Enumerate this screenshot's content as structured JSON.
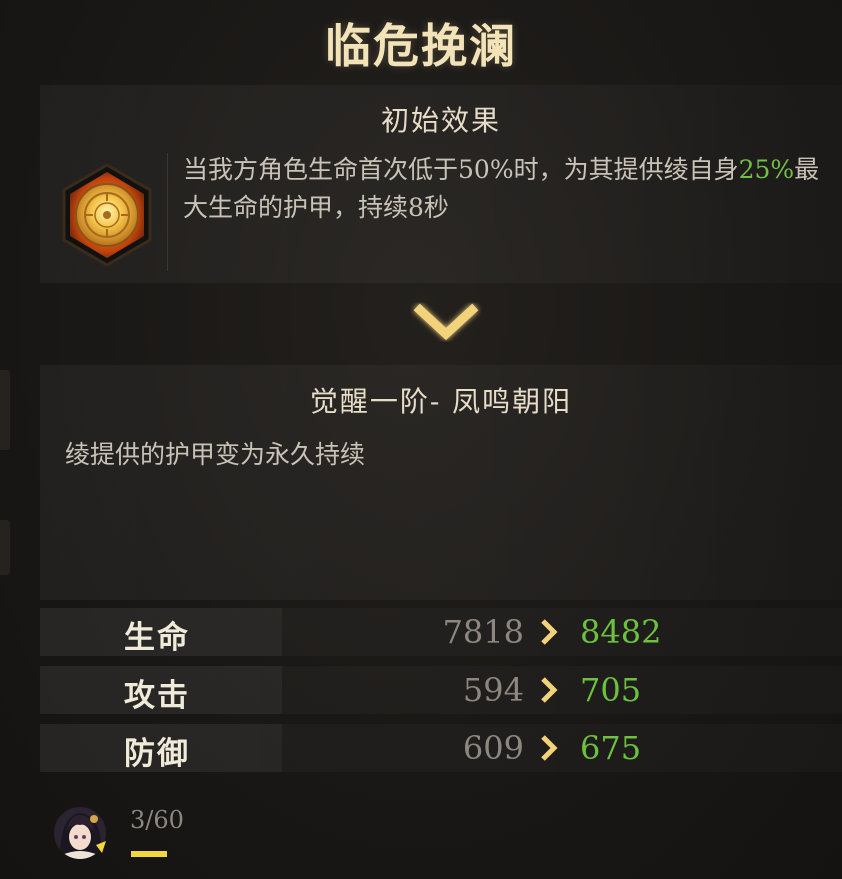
{
  "title": "临危挽澜",
  "initial_effect": {
    "heading": "初始效果",
    "icon": "golden-shield-medallion-icon",
    "description_part1": "当我方角色生命首次低于50%时，为其提供绫自身",
    "description_highlight": "25%",
    "description_part2": "最大生命的护甲，持续8秒"
  },
  "upgrade_arrow_icon": "chevron-down-icon",
  "awakening": {
    "heading": "觉醒一阶- 凤鸣朝阳",
    "description": "绫提供的护甲变为永久持续"
  },
  "stats": [
    {
      "label": "生命",
      "old": "7818",
      "new": "8482"
    },
    {
      "label": "攻击",
      "old": "594",
      "new": "705"
    },
    {
      "label": "防御",
      "old": "609",
      "new": "675"
    }
  ],
  "progress": {
    "text": "3/60",
    "fraction": 0.05
  },
  "colors": {
    "title": "#f3e3b8",
    "highlight_green": "#71c144",
    "new_value_green": "#6cc13e",
    "chevron_gold": "#f2d27a",
    "progress_yellow": "#f2d63e"
  }
}
